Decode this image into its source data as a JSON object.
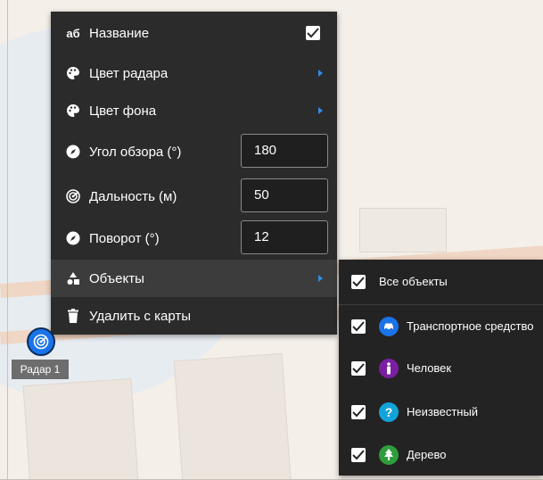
{
  "menu": {
    "items": [
      {
        "label": "Название",
        "icon": "text-ab-icon",
        "checked": true
      },
      {
        "label": "Цвет радара",
        "icon": "palette-icon"
      },
      {
        "label": "Цвет фона",
        "icon": "palette-icon"
      },
      {
        "label": "Угол обзора (°)",
        "icon": "compass-icon",
        "value": "180"
      },
      {
        "label": "Дальность (м)",
        "icon": "radar-icon",
        "value": "50"
      },
      {
        "label": "Поворот (°)",
        "icon": "compass-icon",
        "value": "12"
      },
      {
        "label": "Объекты",
        "icon": "shapes-icon"
      },
      {
        "label": "Удалить с карты",
        "icon": "trash-icon"
      }
    ],
    "icon_text": "аб"
  },
  "submenu": {
    "all": {
      "label": "Все объекты",
      "checked": true
    },
    "items": [
      {
        "label": "Транспортное средство",
        "icon": "car-icon",
        "color": "#1a73e8",
        "checked": true
      },
      {
        "label": "Человек",
        "icon": "person-icon",
        "color": "#7b1fa2",
        "checked": true
      },
      {
        "label": "Неизвестный",
        "icon": "question-icon",
        "color": "#12a4d9",
        "checked": true
      },
      {
        "label": "Дерево",
        "icon": "tree-icon",
        "color": "#2e9d3b",
        "checked": true
      }
    ]
  },
  "radar": {
    "label": "Радар 1"
  },
  "colors": {
    "accent": "#2f8ce8",
    "menu_bg": "#2b2b2b"
  }
}
